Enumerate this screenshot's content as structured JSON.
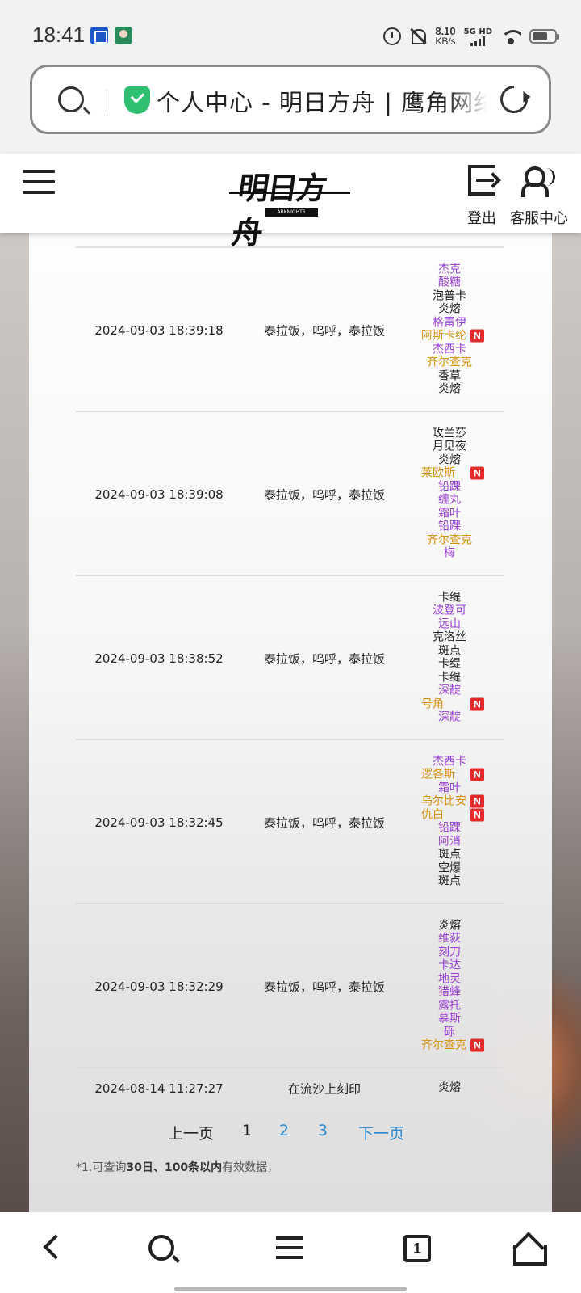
{
  "status_bar": {
    "time": "18:41",
    "net_speed_value": "8.10",
    "net_speed_unit": "KB/s",
    "signal_label": "5G HD",
    "icons": [
      "app-calendar-icon",
      "app-avatar-icon",
      "alarm-icon",
      "mute-icon",
      "signal-icon",
      "wifi-icon",
      "battery-icon"
    ]
  },
  "address_bar": {
    "page_title": "个人中心 - 明日方舟 | 鹰角网络"
  },
  "header": {
    "logo_text": "明日方舟",
    "logo_sub": "ARKNIGHTS",
    "logout_label": "登出",
    "service_label": "客服中心"
  },
  "colors": {
    "operator_normal": "#222222",
    "operator_4star": "#9a3fd4",
    "operator_5star": "#d4900b",
    "new_badge": "#e32b2b",
    "page_link": "#2a8ad0"
  },
  "records": [
    {
      "time": "2024-09-03 18:39:18",
      "source": "泰拉饭，呜呼，泰拉饭",
      "operators": [
        {
          "name": "杰克",
          "rarity": 4,
          "new": false
        },
        {
          "name": "酸糖",
          "rarity": 4,
          "new": false
        },
        {
          "name": "泡普卡",
          "rarity": 3,
          "new": false
        },
        {
          "name": "炎熔",
          "rarity": 3,
          "new": false
        },
        {
          "name": "格雷伊",
          "rarity": 4,
          "new": false
        },
        {
          "name": "阿斯卡纶",
          "rarity": 5,
          "new": true
        },
        {
          "name": "杰西卡",
          "rarity": 4,
          "new": false
        },
        {
          "name": "齐尔查克",
          "rarity": 5,
          "new": false
        },
        {
          "name": "香草",
          "rarity": 3,
          "new": false
        },
        {
          "name": "炎熔",
          "rarity": 3,
          "new": false
        }
      ]
    },
    {
      "time": "2024-09-03 18:39:08",
      "source": "泰拉饭，呜呼，泰拉饭",
      "operators": [
        {
          "name": "玫兰莎",
          "rarity": 3,
          "new": false
        },
        {
          "name": "月见夜",
          "rarity": 3,
          "new": false
        },
        {
          "name": "炎熔",
          "rarity": 3,
          "new": false
        },
        {
          "name": "莱欧斯",
          "rarity": 5,
          "new": true
        },
        {
          "name": "铅踝",
          "rarity": 4,
          "new": false
        },
        {
          "name": "缠丸",
          "rarity": 4,
          "new": false
        },
        {
          "name": "霜叶",
          "rarity": 4,
          "new": false
        },
        {
          "name": "铅踝",
          "rarity": 4,
          "new": false
        },
        {
          "name": "齐尔查克",
          "rarity": 5,
          "new": false
        },
        {
          "name": "梅",
          "rarity": 4,
          "new": false
        }
      ]
    },
    {
      "time": "2024-09-03 18:38:52",
      "source": "泰拉饭，呜呼，泰拉饭",
      "operators": [
        {
          "name": "卡缇",
          "rarity": 3,
          "new": false
        },
        {
          "name": "波登可",
          "rarity": 4,
          "new": false
        },
        {
          "name": "远山",
          "rarity": 4,
          "new": false
        },
        {
          "name": "克洛丝",
          "rarity": 3,
          "new": false
        },
        {
          "name": "斑点",
          "rarity": 3,
          "new": false
        },
        {
          "name": "卡缇",
          "rarity": 3,
          "new": false
        },
        {
          "name": "卡缇",
          "rarity": 3,
          "new": false
        },
        {
          "name": "深靛",
          "rarity": 4,
          "new": false
        },
        {
          "name": "号角",
          "rarity": 5,
          "new": true
        },
        {
          "name": "深靛",
          "rarity": 4,
          "new": false
        }
      ]
    },
    {
      "time": "2024-09-03 18:32:45",
      "source": "泰拉饭，呜呼，泰拉饭",
      "operators": [
        {
          "name": "杰西卡",
          "rarity": 4,
          "new": false
        },
        {
          "name": "逻各斯",
          "rarity": 5,
          "new": true
        },
        {
          "name": "霜叶",
          "rarity": 4,
          "new": false
        },
        {
          "name": "乌尔比安",
          "rarity": 5,
          "new": true
        },
        {
          "name": "仇白",
          "rarity": 5,
          "new": true
        },
        {
          "name": "铅踝",
          "rarity": 4,
          "new": false
        },
        {
          "name": "阿消",
          "rarity": 4,
          "new": false
        },
        {
          "name": "斑点",
          "rarity": 3,
          "new": false
        },
        {
          "name": "空爆",
          "rarity": 3,
          "new": false
        },
        {
          "name": "斑点",
          "rarity": 3,
          "new": false
        }
      ]
    },
    {
      "time": "2024-09-03 18:32:29",
      "source": "泰拉饭，呜呼，泰拉饭",
      "operators": [
        {
          "name": "炎熔",
          "rarity": 3,
          "new": false
        },
        {
          "name": "维荻",
          "rarity": 4,
          "new": false
        },
        {
          "name": "刻刀",
          "rarity": 4,
          "new": false
        },
        {
          "name": "卡达",
          "rarity": 4,
          "new": false
        },
        {
          "name": "地灵",
          "rarity": 4,
          "new": false
        },
        {
          "name": "猎蜂",
          "rarity": 4,
          "new": false
        },
        {
          "name": "露托",
          "rarity": 4,
          "new": false
        },
        {
          "name": "慕斯",
          "rarity": 4,
          "new": false
        },
        {
          "name": "砾",
          "rarity": 4,
          "new": false
        },
        {
          "name": "齐尔查克",
          "rarity": 5,
          "new": true
        }
      ]
    },
    {
      "time": "2024-08-14 11:27:27",
      "source": "在流沙上刻印",
      "operators": [
        {
          "name": "炎熔",
          "rarity": 3,
          "new": false
        }
      ]
    }
  ],
  "pagination": {
    "prev_label": "上一页",
    "pages": [
      "1",
      "2",
      "3"
    ],
    "current_page": "1",
    "next_label": "下一页"
  },
  "note": {
    "prefix": "*1.可查询",
    "bold": "30日、100条以内",
    "suffix": "有效数据，"
  },
  "bottom_nav": {
    "tab_count": "1",
    "icons": [
      "back-icon",
      "search-icon",
      "menu-icon",
      "tabs-icon",
      "home-icon"
    ]
  }
}
